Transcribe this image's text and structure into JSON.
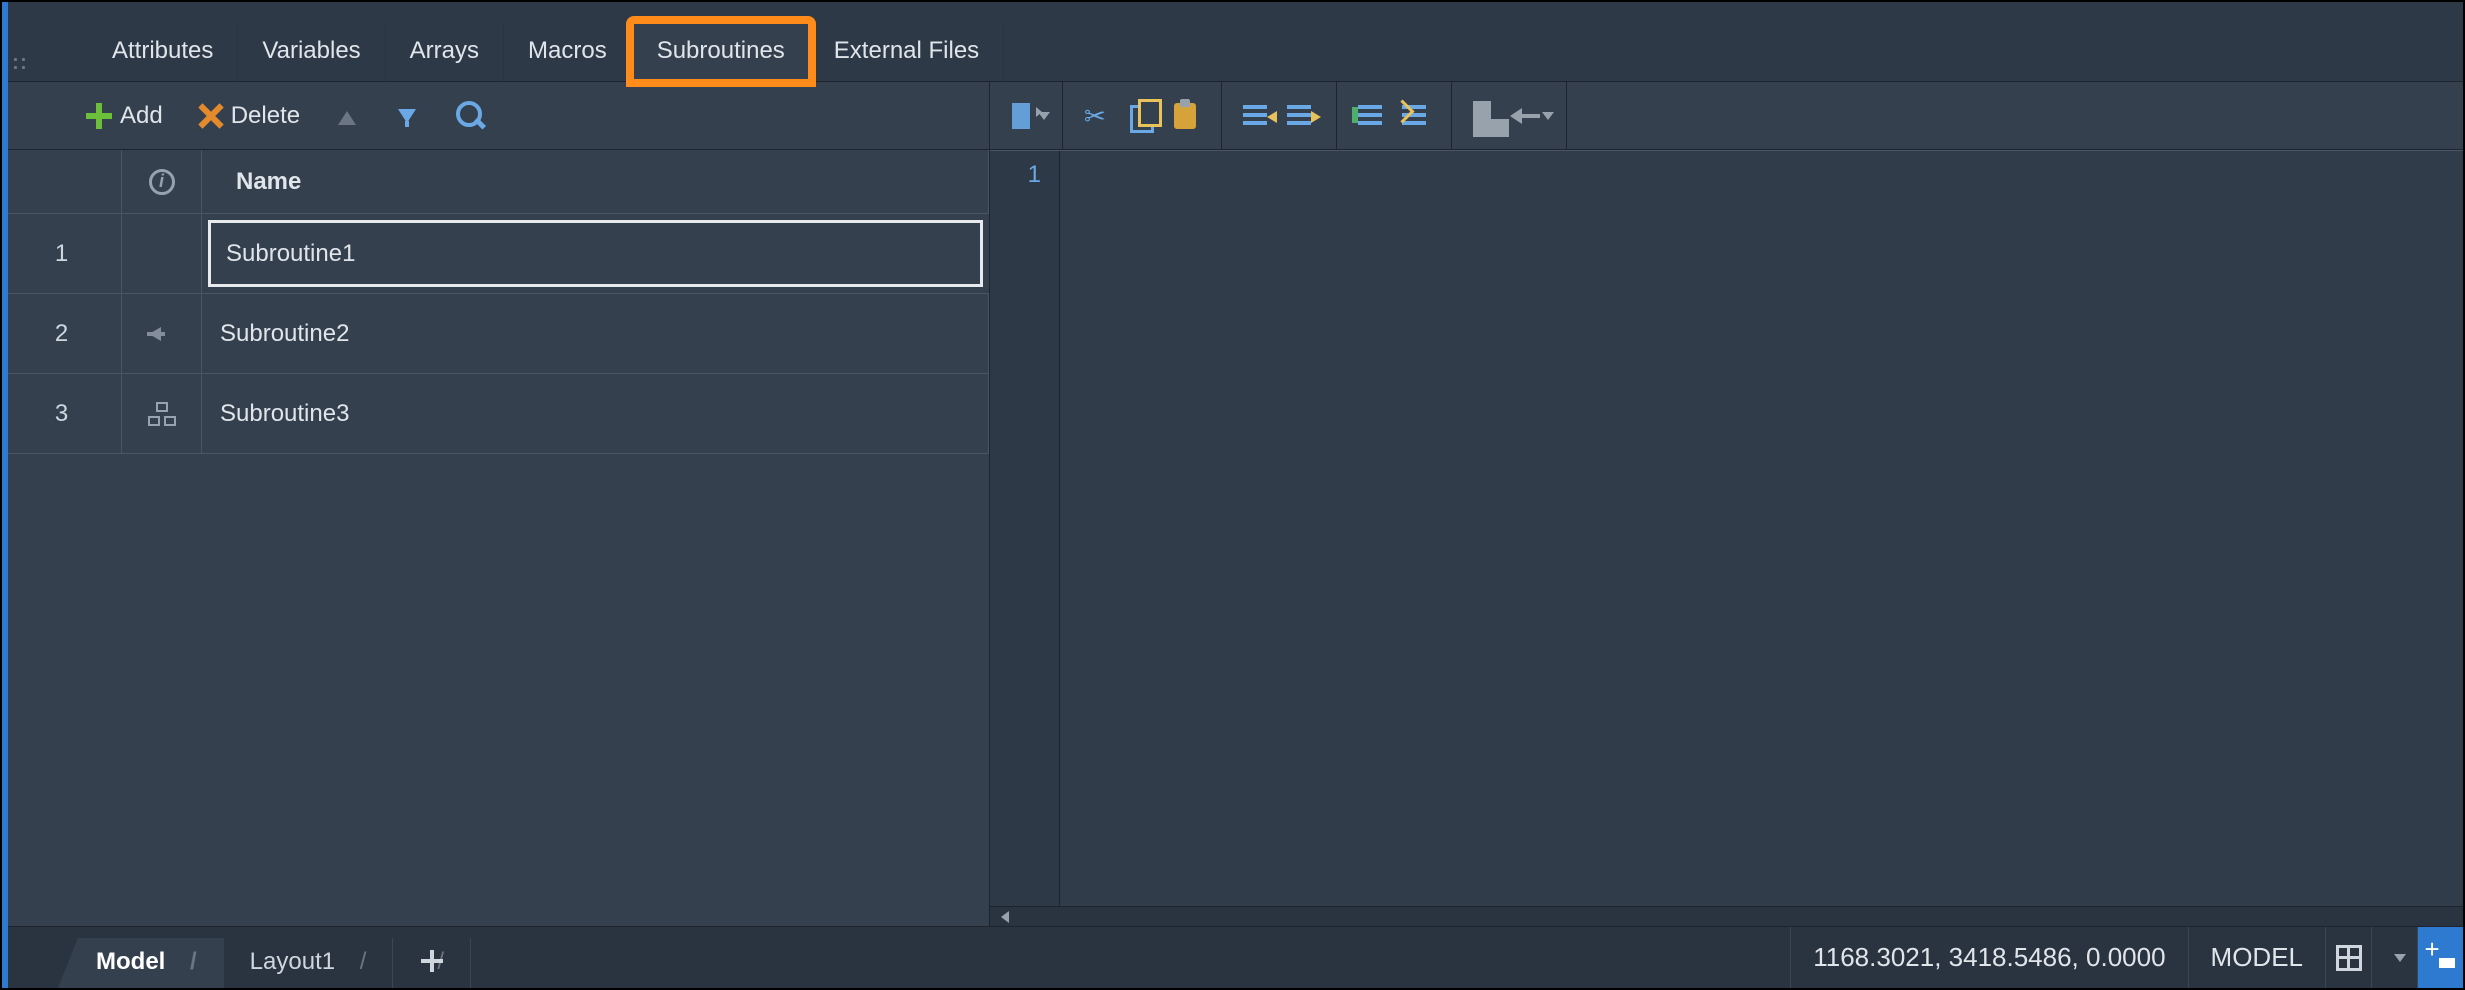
{
  "tabs": {
    "items": [
      {
        "label": "Attributes"
      },
      {
        "label": "Variables"
      },
      {
        "label": "Arrays"
      },
      {
        "label": "Macros"
      },
      {
        "label": "Subroutines"
      },
      {
        "label": "External Files"
      }
    ],
    "active_index": 4,
    "highlight_index": 4
  },
  "left_toolbar": {
    "add_label": "Add",
    "delete_label": "Delete"
  },
  "list": {
    "header": {
      "name_col": "Name"
    },
    "rows": [
      {
        "num": "1",
        "type_icon": "",
        "name": "Subroutine1",
        "selected": true
      },
      {
        "num": "2",
        "type_icon": "arrow",
        "name": "Subroutine2",
        "selected": false
      },
      {
        "num": "3",
        "type_icon": "tree",
        "name": "Subroutine3",
        "selected": false
      }
    ]
  },
  "editor": {
    "gutter_lines": [
      "1"
    ]
  },
  "statusbar": {
    "tabs": [
      {
        "label": "Model",
        "active": true
      },
      {
        "label": "Layout1",
        "active": false
      }
    ],
    "coords": "1168.3021, 3418.5486, 0.0000",
    "space": "MODEL"
  }
}
